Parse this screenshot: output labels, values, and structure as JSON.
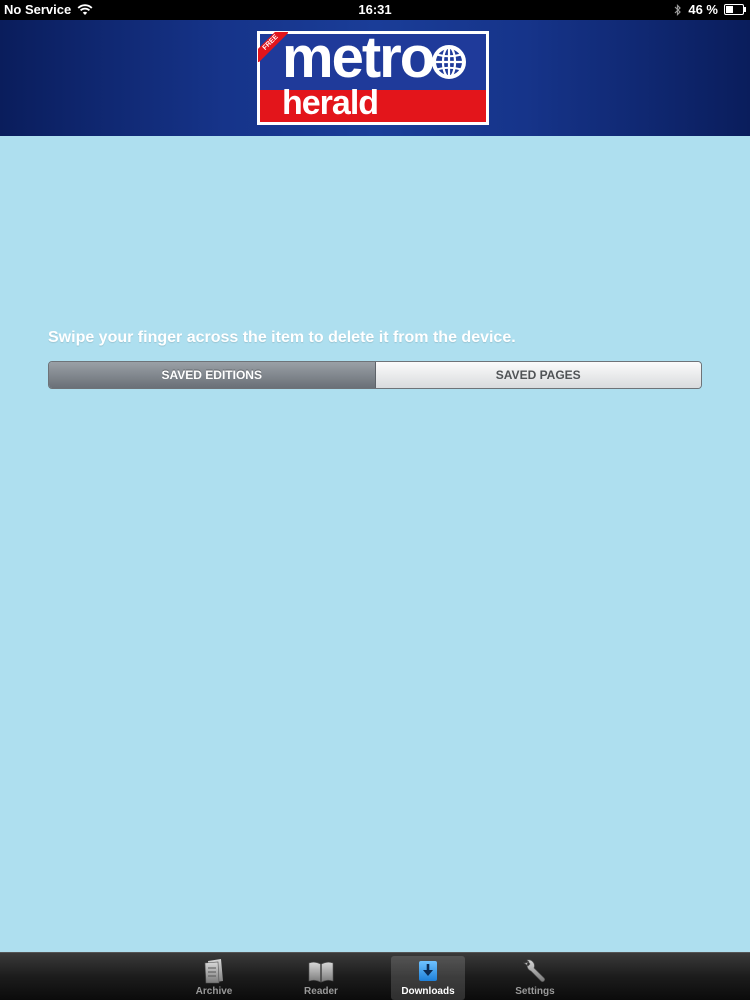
{
  "status_bar": {
    "carrier": "No Service",
    "time": "16:31",
    "battery_percent": "46 %",
    "battery_level": 0.46
  },
  "header": {
    "logo_badge": "FREE",
    "logo_top": "metro",
    "logo_bottom": "herald"
  },
  "main": {
    "instruction": "Swipe your finger across the item to delete it from the device.",
    "segments": [
      {
        "label": "SAVED EDITIONS",
        "selected": true
      },
      {
        "label": "SAVED PAGES",
        "selected": false
      }
    ]
  },
  "tab_bar": {
    "tabs": [
      {
        "label": "Archive",
        "icon": "archive-icon",
        "active": false
      },
      {
        "label": "Reader",
        "icon": "book-icon",
        "active": false
      },
      {
        "label": "Downloads",
        "icon": "download-icon",
        "active": true
      },
      {
        "label": "Settings",
        "icon": "wrench-icon",
        "active": false
      }
    ]
  },
  "colors": {
    "background": "#aedfef",
    "header_blue": "#1f3a9a",
    "logo_red": "#e3151b",
    "tab_active_icon": "#1e8ee6"
  }
}
